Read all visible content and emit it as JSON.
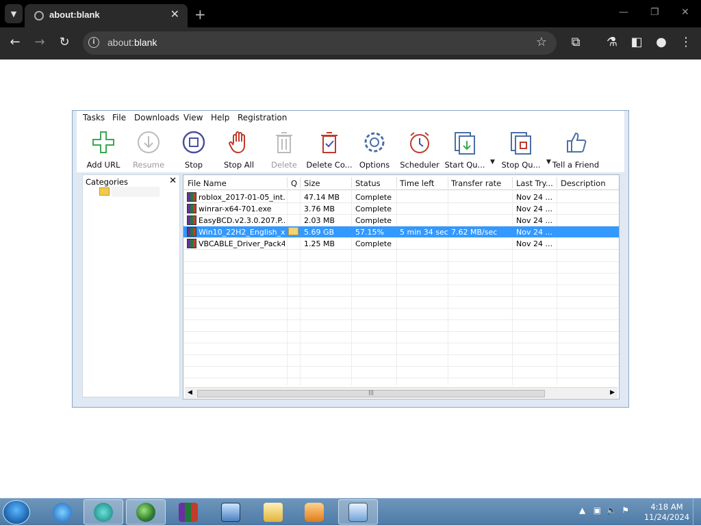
{
  "browser": {
    "tab_title": "about:blank",
    "url_prefix": "about:",
    "url_host": "blank",
    "new_tab": "+",
    "tab_close": "✕"
  },
  "idm": {
    "menu": [
      "Tasks",
      "File",
      "Downloads",
      "View",
      "Help",
      "Registration"
    ],
    "toolbar": [
      {
        "label": "Add URL",
        "icon": "add-url-icon",
        "enabled": true
      },
      {
        "label": "Resume",
        "icon": "resume-icon",
        "enabled": false
      },
      {
        "label": "Stop",
        "icon": "stop-icon",
        "enabled": true
      },
      {
        "label": "Stop All",
        "icon": "stop-all-icon",
        "enabled": true
      },
      {
        "label": "Delete",
        "icon": "delete-icon",
        "enabled": false
      },
      {
        "label": "Delete Co...",
        "icon": "delete-completed-icon",
        "enabled": true
      },
      {
        "label": "Options",
        "icon": "options-icon",
        "enabled": true
      },
      {
        "label": "Scheduler",
        "icon": "scheduler-icon",
        "enabled": true
      },
      {
        "label": "Start Qu...",
        "icon": "start-queue-icon",
        "enabled": true
      },
      {
        "label": "Stop Qu...",
        "icon": "stop-queue-icon",
        "enabled": true
      },
      {
        "label": "Tell a Friend",
        "icon": "tell-friend-icon",
        "enabled": true
      }
    ],
    "categories_title": "Categories",
    "columns": [
      "File Name",
      "Q",
      "Size",
      "Status",
      "Time left",
      "Transfer rate",
      "Last Try...",
      "Description"
    ],
    "rows": [
      {
        "name": "roblox_2017-01-05_int...",
        "q": "",
        "size": "47.14  MB",
        "status": "Complete",
        "time_left": "",
        "rate": "",
        "last_try": "Nov 24 ...",
        "selected": false
      },
      {
        "name": "winrar-x64-701.exe",
        "q": "",
        "size": "3.76  MB",
        "status": "Complete",
        "time_left": "",
        "rate": "",
        "last_try": "Nov 24 ...",
        "selected": false
      },
      {
        "name": "EasyBCD.v2.3.0.207.P...",
        "q": "",
        "size": "2.03  MB",
        "status": "Complete",
        "time_left": "",
        "rate": "",
        "last_try": "Nov 24 ...",
        "selected": false
      },
      {
        "name": "Win10_22H2_English_x...",
        "q": "folder",
        "size": "5.69  GB",
        "status": "57.15%",
        "time_left": "5 min 34 sec",
        "rate": "7.62  MB/sec",
        "last_try": "Nov 24 ...",
        "selected": true
      },
      {
        "name": "VBCABLE_Driver_Pack4...",
        "q": "",
        "size": "1.25  MB",
        "status": "Complete",
        "time_left": "",
        "rate": "",
        "last_try": "Nov 24 ...",
        "selected": false
      }
    ]
  },
  "taskbar": {
    "time": "4:18 AM",
    "date": "11/24/2024",
    "apps": [
      "internet-explorer",
      "app-teal",
      "idm",
      "winrar",
      "computer",
      "explorer",
      "media-player",
      "control-panel"
    ]
  },
  "colors": {
    "selection": "#3399ff",
    "chrome_bg": "#000000",
    "taskbar": "#5a86b0"
  }
}
